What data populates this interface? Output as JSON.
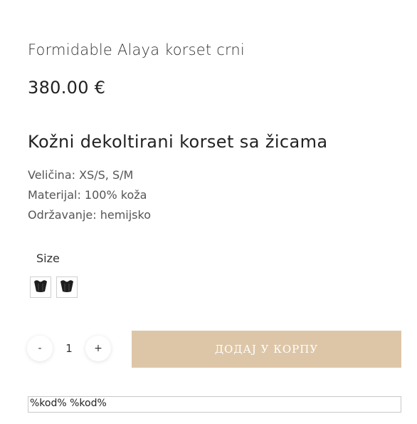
{
  "product": {
    "title": "Formidable Alaya korset crni",
    "price": "380.00 €",
    "headline": "Kožni dekoltirani korset sa žicama",
    "details": [
      "Veličina: XS/S, S/M",
      "Materijal: 100% koža",
      "Održavanje: hemijsko"
    ]
  },
  "size": {
    "label": "Size",
    "swatches": [
      {
        "icon": "corset-thumbnail-icon"
      },
      {
        "icon": "corset-thumbnail-icon"
      }
    ]
  },
  "quantity": {
    "minus": "-",
    "value": "1",
    "plus": "+"
  },
  "cart": {
    "add_label": "ДОДАЈ У КОРПУ",
    "button_color": "#ddc6a7"
  },
  "code_field": {
    "value": "%kod% %kod%"
  }
}
